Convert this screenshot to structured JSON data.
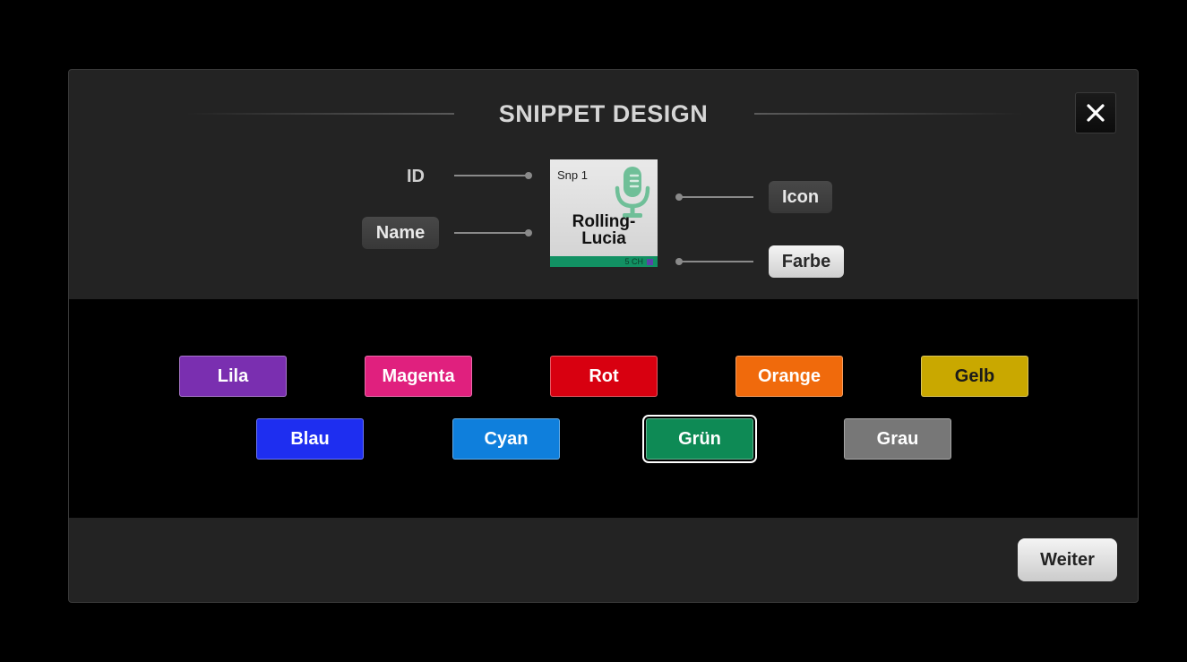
{
  "dialog": {
    "title": "SNIPPET DESIGN",
    "close_icon": "close-icon"
  },
  "preview": {
    "id_label": "ID",
    "name_button": "Name",
    "icon_button": "Icon",
    "color_button": "Farbe",
    "tile": {
      "id": "Snp 1",
      "name_line1": "Rolling-",
      "name_line2": "Lucia",
      "channels": "5 CH",
      "icon": "microphone-icon",
      "icon_color": "#6fbf98",
      "bar_color": "#129163"
    }
  },
  "colors": {
    "row1": [
      {
        "label": "Lila",
        "color": "#7a2fb0",
        "selected": false
      },
      {
        "label": "Magenta",
        "color": "#e0207e",
        "selected": false
      },
      {
        "label": "Rot",
        "color": "#d80010",
        "selected": false
      },
      {
        "label": "Orange",
        "color": "#f06a0c",
        "selected": false
      },
      {
        "label": "Gelb",
        "color": "#c9a800",
        "selected": false
      }
    ],
    "row2": [
      {
        "label": "Blau",
        "color": "#1e2ef0",
        "selected": false
      },
      {
        "label": "Cyan",
        "color": "#0f7fdc",
        "selected": false
      },
      {
        "label": "Grün",
        "color": "#0e8a55",
        "selected": true
      },
      {
        "label": "Grau",
        "color": "#777777",
        "selected": false
      }
    ]
  },
  "footer": {
    "next_label": "Weiter"
  }
}
